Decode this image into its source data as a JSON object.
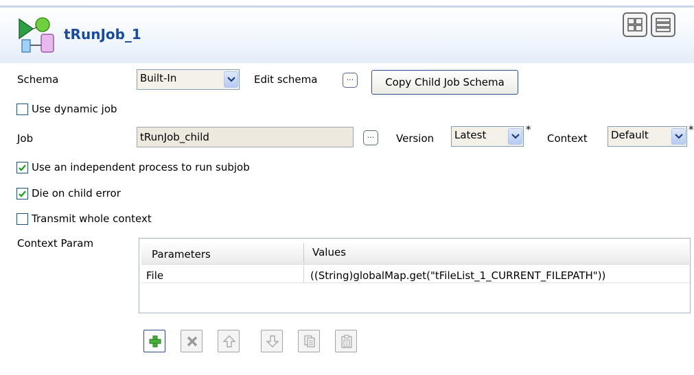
{
  "header": {
    "title": "tRunJob_1",
    "colors": {
      "title": "#1a4b9c",
      "header_bg": "#eef4fc"
    },
    "icons": [
      "run-job-component-icon",
      "grid-view-icon",
      "list-view-icon"
    ]
  },
  "schema": {
    "label": "Schema",
    "value": "Built-In",
    "edit_label": "Edit schema",
    "edit_button": "...",
    "copy_button": "Copy Child Job Schema"
  },
  "dynamic_job": {
    "label": "Use dynamic job",
    "checked": false
  },
  "job": {
    "label": "Job",
    "value": "tRunJob_child",
    "browse_button": "...",
    "version_label": "Version",
    "version_value": "Latest",
    "version_required": "*",
    "context_label": "Context",
    "context_value": "Default",
    "context_required": "*"
  },
  "options": [
    {
      "label": "Use an independent process to run subjob",
      "checked": true
    },
    {
      "label": "Die on child error",
      "checked": true
    },
    {
      "label": "Transmit whole context",
      "checked": false
    }
  ],
  "context_param": {
    "label": "Context Param",
    "columns": [
      "Parameters",
      "Values"
    ],
    "rows": [
      {
        "parameter": "File",
        "value": "((String)globalMap.get(\"tFileList_1_CURRENT_FILEPATH\"))"
      }
    ]
  },
  "table_toolbar": {
    "buttons": [
      {
        "icon": "add-icon",
        "enabled": true
      },
      {
        "icon": "delete-icon",
        "enabled": false
      },
      {
        "icon": "move-up-icon",
        "enabled": false
      },
      {
        "icon": "move-down-icon",
        "enabled": false
      },
      {
        "icon": "copy-icon",
        "enabled": false
      },
      {
        "icon": "paste-icon",
        "enabled": false
      }
    ]
  }
}
